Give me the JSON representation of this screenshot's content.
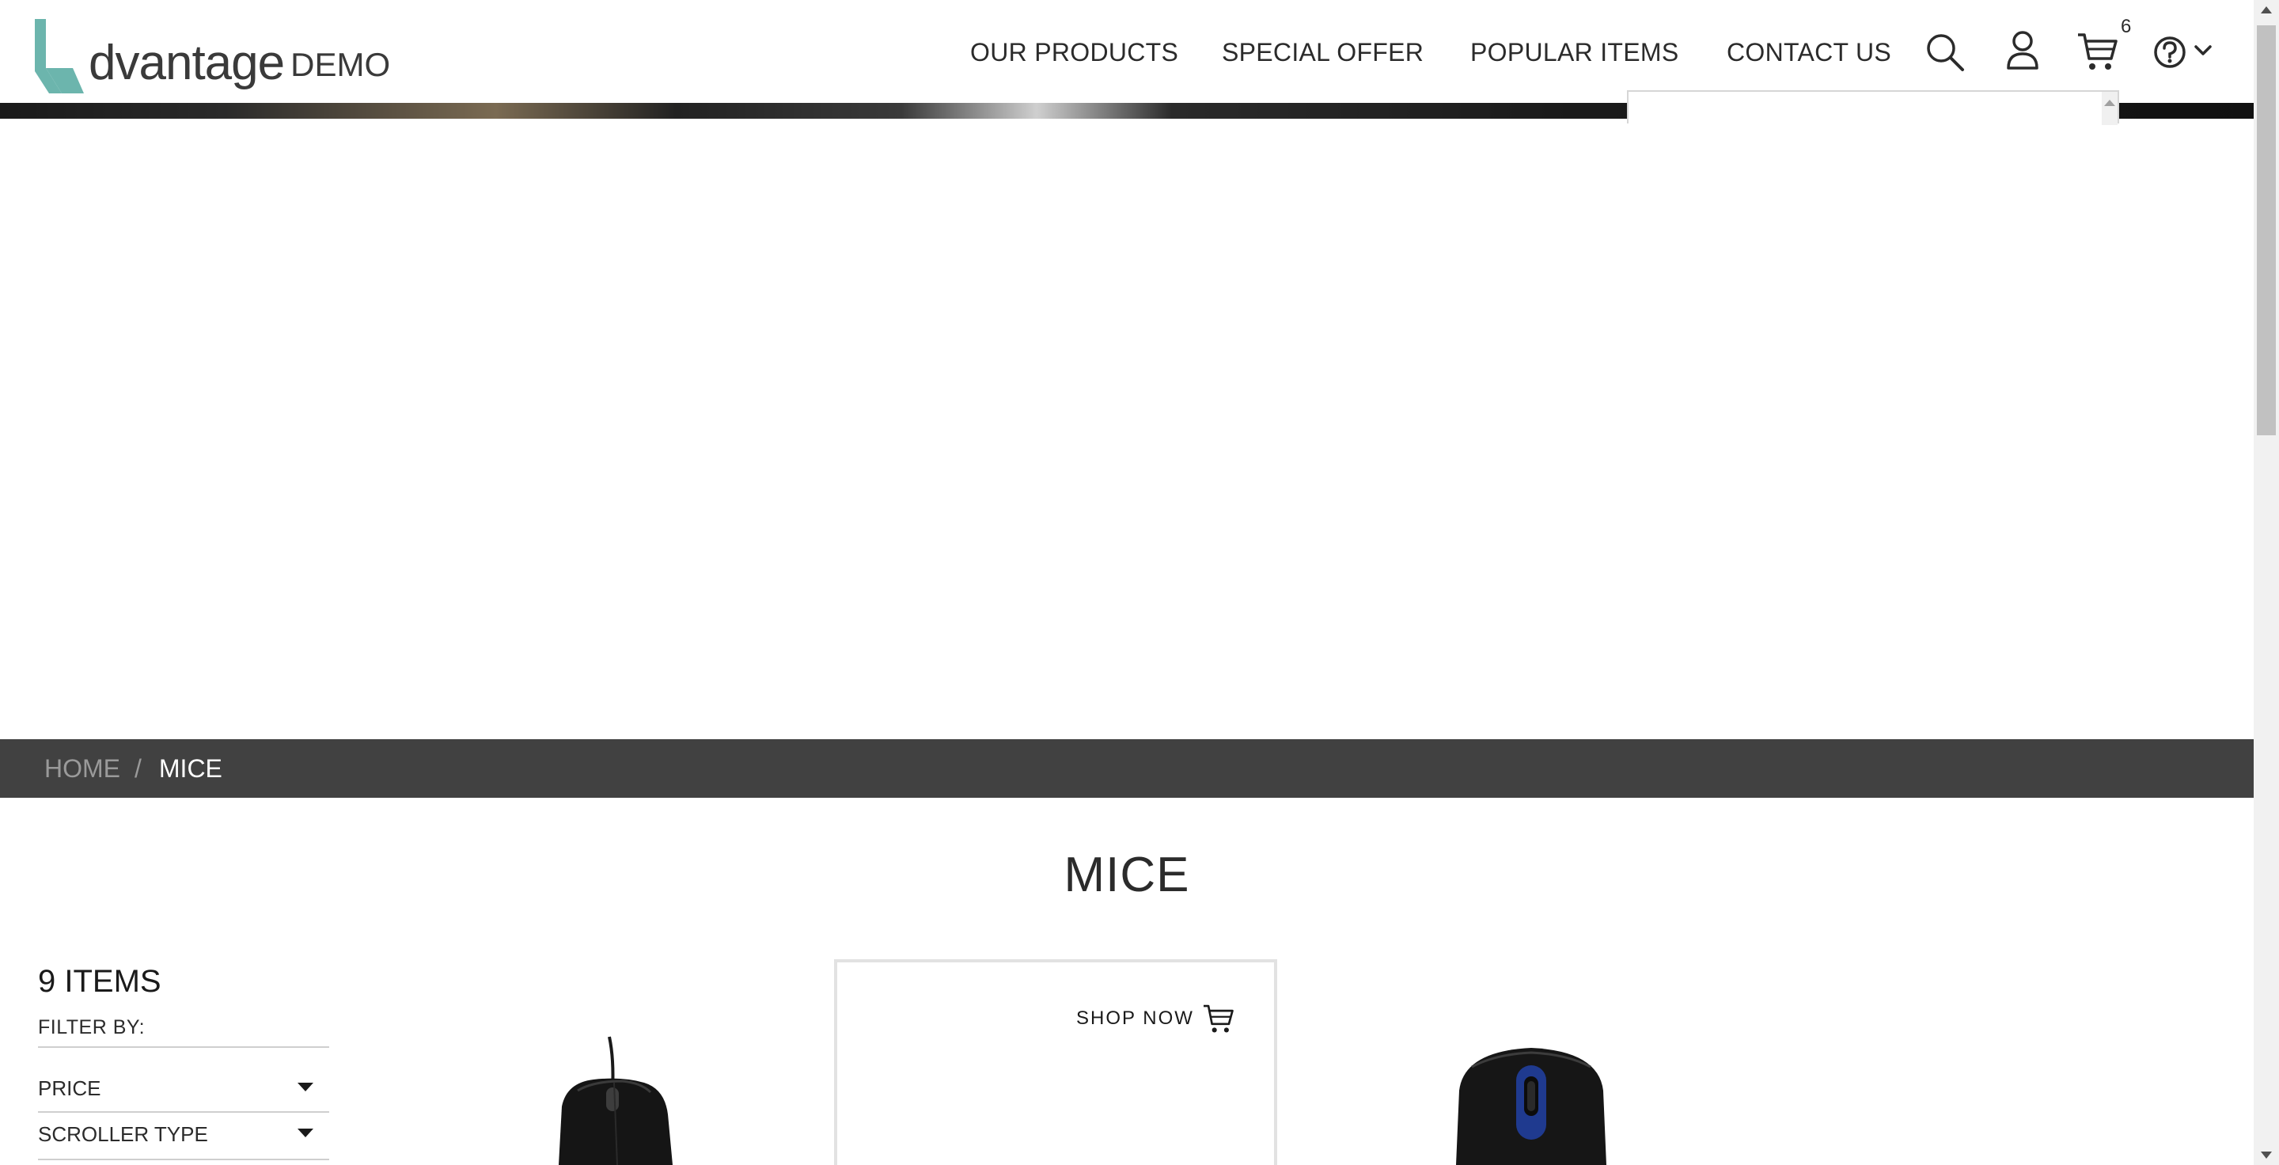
{
  "header": {
    "logo": {
      "word": "dvantage",
      "suffix": "DEMO",
      "accent_color": "#6cb5ad"
    },
    "nav": [
      {
        "label": "OUR PRODUCTS"
      },
      {
        "label": "SPECIAL OFFER"
      },
      {
        "label": "POPULAR ITEMS"
      },
      {
        "label": "CONTACT US"
      }
    ],
    "icons": [
      "search-icon",
      "user-icon",
      "cart-icon",
      "help-icon",
      "chevron-down-icon"
    ],
    "cart_count": "6"
  },
  "breadcrumb": {
    "home": "HOME",
    "separator": "/",
    "current": "MICE"
  },
  "category": {
    "title": "MICE"
  },
  "filters": {
    "items_count": "9 ITEMS",
    "filter_by": "FILTER BY:",
    "groups": [
      {
        "label": "PRICE"
      },
      {
        "label": "SCROLLER TYPE"
      }
    ]
  },
  "products": {
    "shop_now_label": "SHOP NOW"
  },
  "colors": {
    "breadcrumb_bg": "#414141",
    "accent": "#6cb5ad"
  }
}
